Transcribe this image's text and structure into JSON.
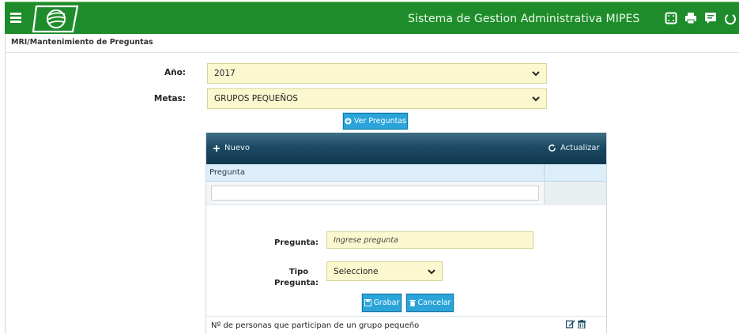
{
  "header": {
    "app_title": "Sistema de Gestion Administrativa MIPES",
    "icons": [
      "menu-icon",
      "logo",
      "expand-icon",
      "print-icon",
      "message-icon",
      "power-icon"
    ]
  },
  "breadcrumb": "MRI/Mantenimiento de Preguntas",
  "filters": {
    "year_label": "Año:",
    "year_value": "2017",
    "goal_label": "Metas:",
    "goal_value": "GRUPOS PEQUEÑOS",
    "view_button": "Ver Preguntas"
  },
  "grid": {
    "toolbar_new": "Nuevo",
    "toolbar_refresh": "Actualizar",
    "column_question": "Pregunta",
    "filter_value": "",
    "editor": {
      "question_label": "Pregunta:",
      "question_placeholder": "Ingrese pregunta",
      "type_label_1": "Tipo",
      "type_label_2": "Pregunta:",
      "type_value": "Seleccione",
      "save_button": "Grabar",
      "cancel_button": "Cancelar"
    },
    "rows": [
      {
        "question": "Nº de personas que participan de un grupo pequeño"
      }
    ]
  },
  "colors": {
    "header_green": "#1f8c2c",
    "field_yellow": "#fbf8cf",
    "button_blue": "#2aa4d9",
    "toolbar_navy": "#1d4a63"
  }
}
